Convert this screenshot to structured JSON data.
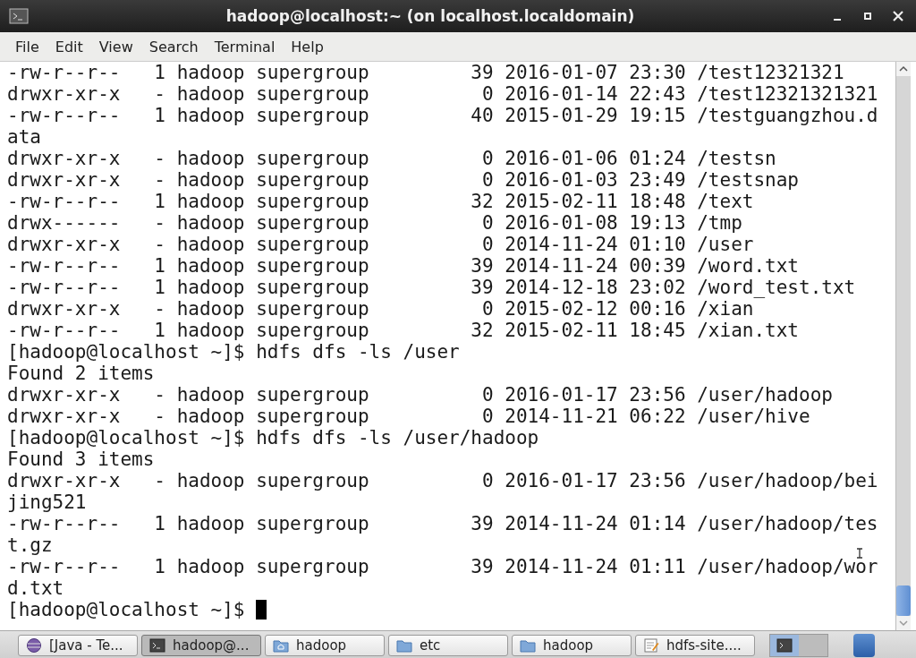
{
  "window": {
    "title": "hadoop@localhost:~ (on localhost.localdomain)"
  },
  "menu": [
    "File",
    "Edit",
    "View",
    "Search",
    "Terminal",
    "Help"
  ],
  "terminal": {
    "lines": [
      "-rw-r--r--   1 hadoop supergroup         39 2016-01-07 23:30 /test12321321",
      "drwxr-xr-x   - hadoop supergroup          0 2016-01-14 22:43 /test12321321321",
      "-rw-r--r--   1 hadoop supergroup         40 2015-01-29 19:15 /testguangzhou.d",
      "ata",
      "drwxr-xr-x   - hadoop supergroup          0 2016-01-06 01:24 /testsn",
      "drwxr-xr-x   - hadoop supergroup          0 2016-01-03 23:49 /testsnap",
      "-rw-r--r--   1 hadoop supergroup         32 2015-02-11 18:48 /text",
      "drwx------   - hadoop supergroup          0 2016-01-08 19:13 /tmp",
      "drwxr-xr-x   - hadoop supergroup          0 2014-11-24 01:10 /user",
      "-rw-r--r--   1 hadoop supergroup         39 2014-11-24 00:39 /word.txt",
      "-rw-r--r--   1 hadoop supergroup         39 2014-12-18 23:02 /word_test.txt",
      "drwxr-xr-x   - hadoop supergroup          0 2015-02-12 00:16 /xian",
      "-rw-r--r--   1 hadoop supergroup         32 2015-02-11 18:45 /xian.txt",
      "[hadoop@localhost ~]$ hdfs dfs -ls /user",
      "Found 2 items",
      "drwxr-xr-x   - hadoop supergroup          0 2016-01-17 23:56 /user/hadoop",
      "drwxr-xr-x   - hadoop supergroup          0 2014-11-21 06:22 /user/hive",
      "[hadoop@localhost ~]$ hdfs dfs -ls /user/hadoop",
      "Found 3 items",
      "drwxr-xr-x   - hadoop supergroup          0 2016-01-17 23:56 /user/hadoop/bei",
      "jing521",
      "-rw-r--r--   1 hadoop supergroup         39 2014-11-24 01:14 /user/hadoop/tes",
      "t.gz",
      "-rw-r--r--   1 hadoop supergroup         39 2014-11-24 01:11 /user/hadoop/wor",
      "d.txt",
      "[hadoop@localhost ~]$ "
    ]
  },
  "taskbar": [
    {
      "label": "[Java - Te...",
      "kind": "app",
      "selected": false
    },
    {
      "label": "hadoop@...",
      "kind": "terminal",
      "selected": true
    },
    {
      "label": "hadoop",
      "kind": "home-folder",
      "selected": false
    },
    {
      "label": "etc",
      "kind": "folder",
      "selected": false
    },
    {
      "label": "hadoop",
      "kind": "folder",
      "selected": false
    },
    {
      "label": "hdfs-site....",
      "kind": "editor",
      "selected": false
    }
  ]
}
